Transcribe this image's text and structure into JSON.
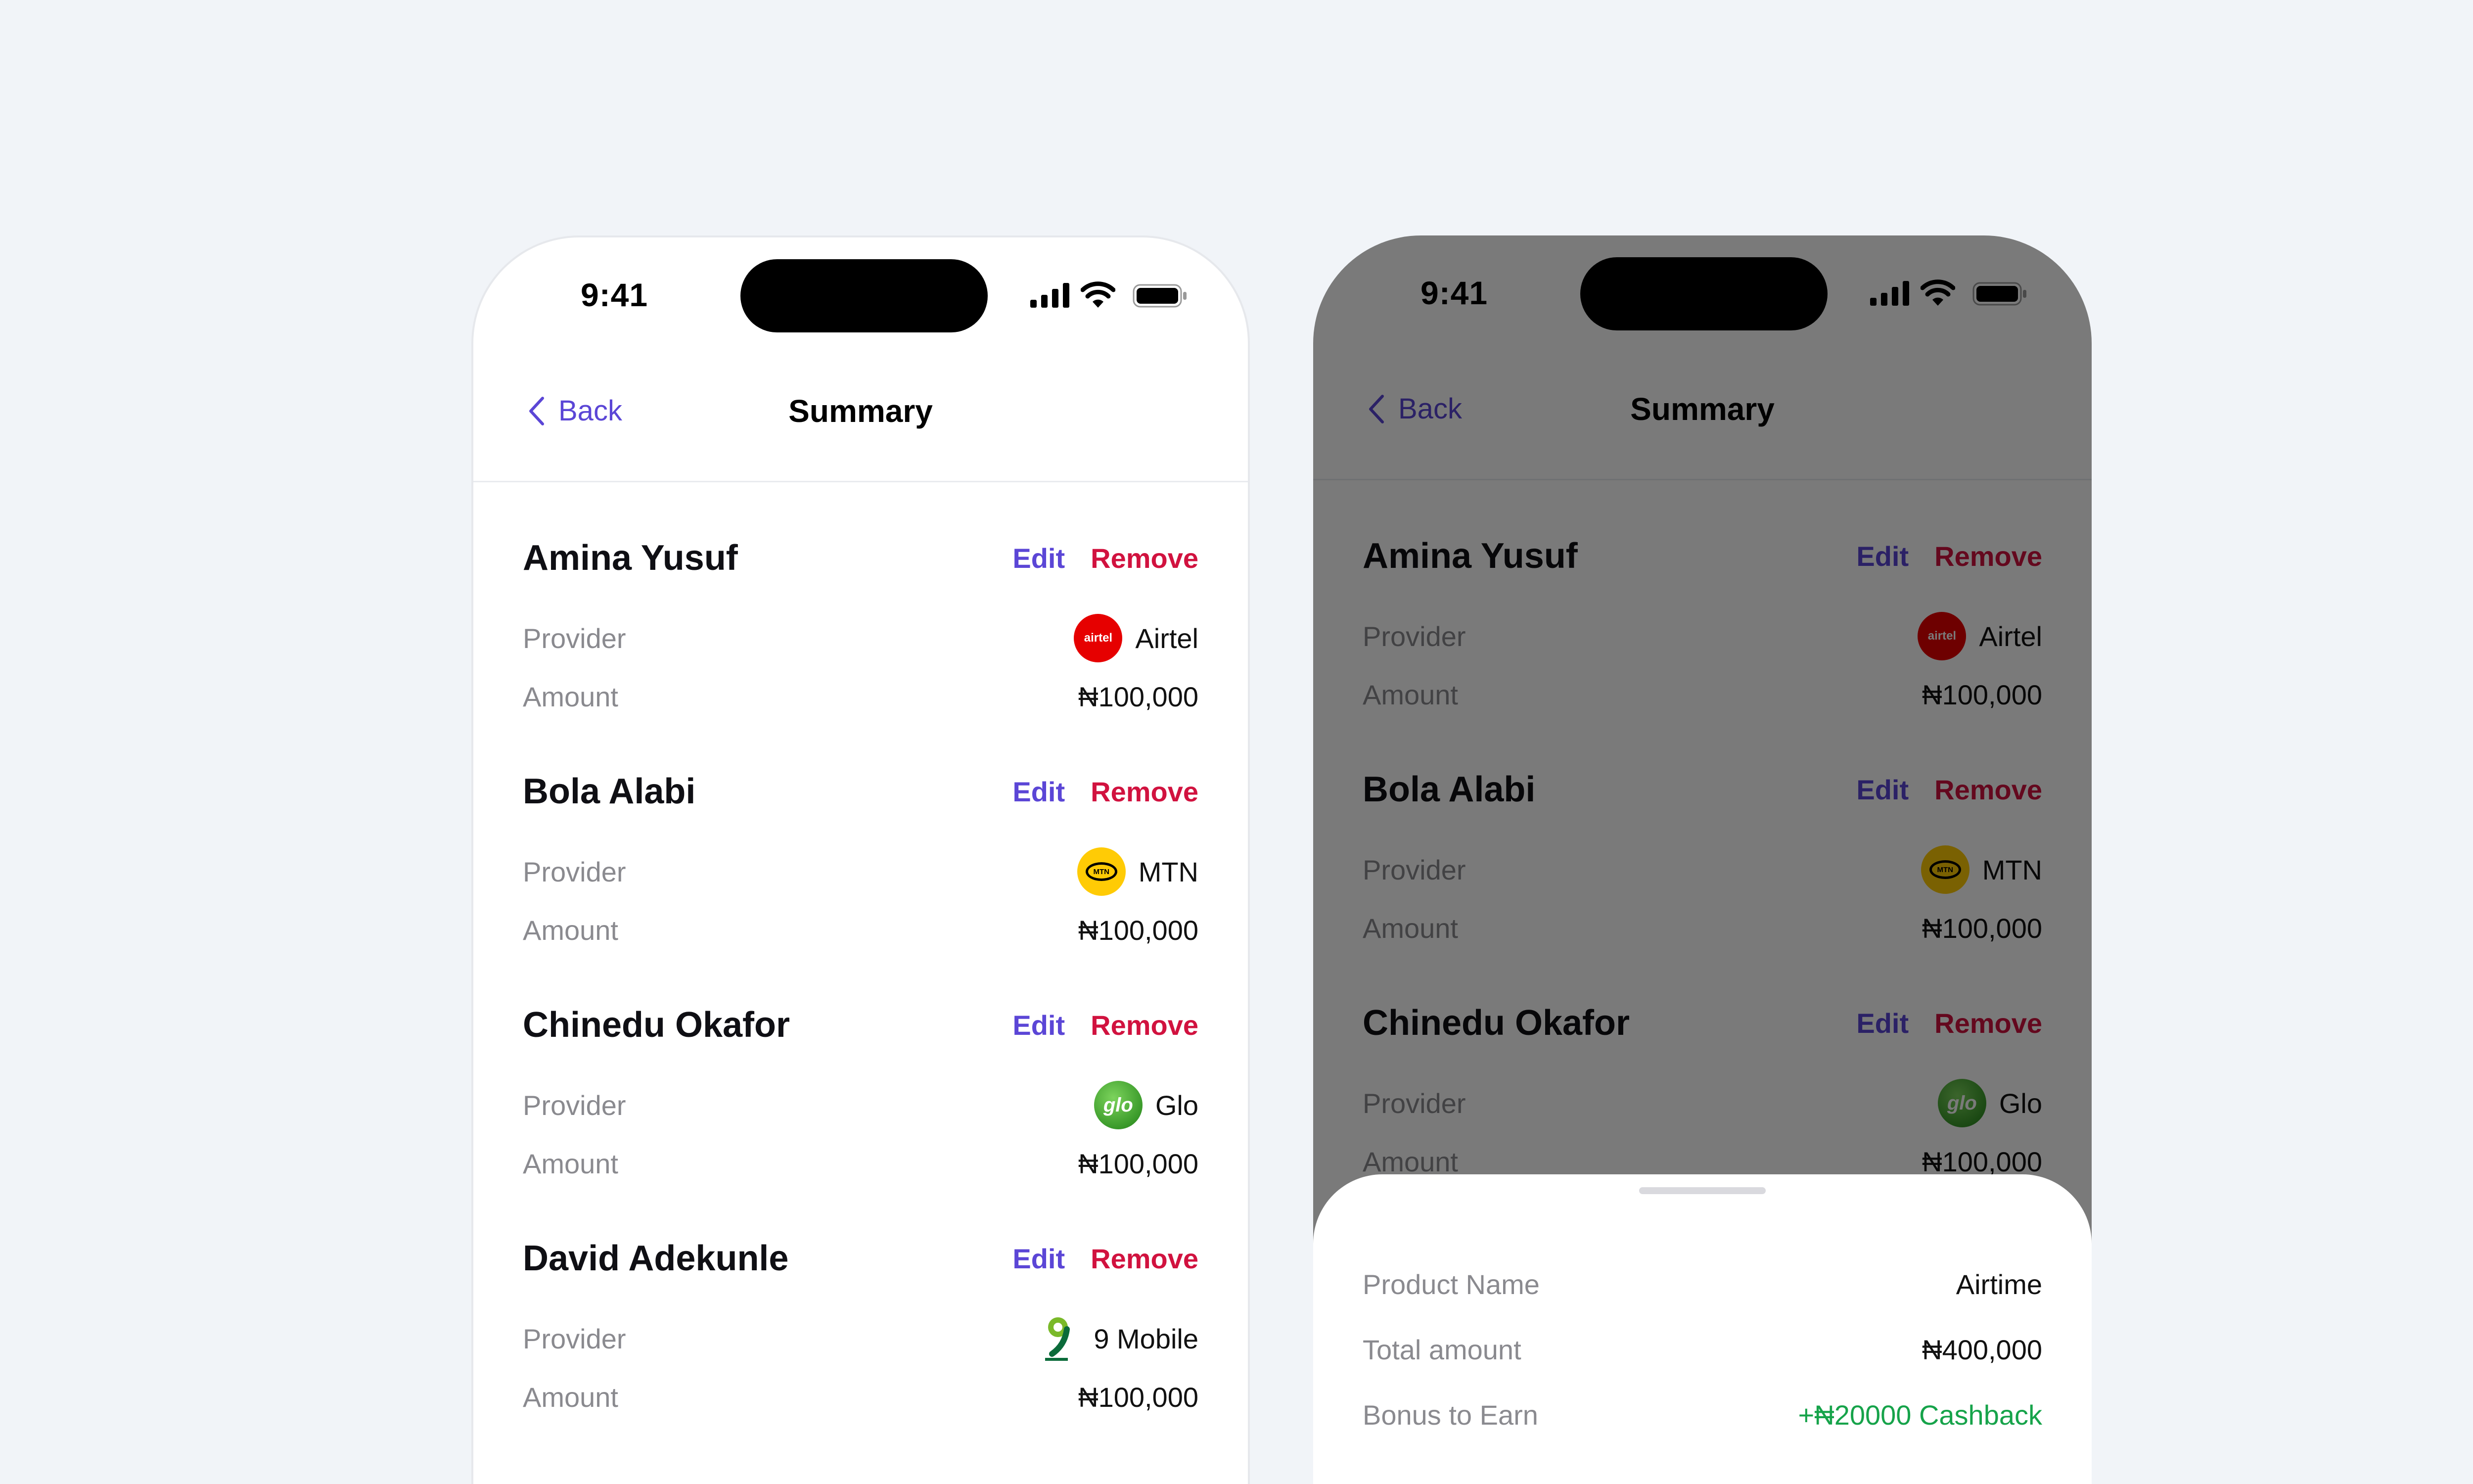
{
  "status": {
    "time": "9:41"
  },
  "nav": {
    "back_label": "Back",
    "title": "Summary"
  },
  "labels": {
    "edit": "Edit",
    "remove": "Remove",
    "provider": "Provider",
    "amount": "Amount"
  },
  "recipients": [
    {
      "name": "Amina Yusuf",
      "provider": "Airtel",
      "provider_logo": "airtel-logo-icon",
      "logo_text": "airtel",
      "amount": "₦100,000"
    },
    {
      "name": "Bola Alabi",
      "provider": "MTN",
      "provider_logo": "mtn-logo-icon",
      "logo_text": "MTN",
      "amount": "₦100,000"
    },
    {
      "name": "Chinedu Okafor",
      "provider": "Glo",
      "provider_logo": "glo-logo-icon",
      "logo_text": "glo",
      "amount": "₦100,000"
    },
    {
      "name": "David Adekunle",
      "provider": "9 Mobile",
      "provider_logo": "9mobile-logo-icon",
      "amount": "₦100,000"
    }
  ],
  "summary_sheet": {
    "product_name_label": "Product Name",
    "product_name_value": "Airtime",
    "total_amount_label": "Total amount",
    "total_amount_value": "₦400,000",
    "bonus_label": "Bonus to Earn",
    "bonus_value": "+₦20000 Cashback"
  },
  "colors": {
    "accent": "#5b46d6",
    "danger": "#d1123f",
    "success": "#16a34a",
    "background": "#f1f4f8"
  }
}
